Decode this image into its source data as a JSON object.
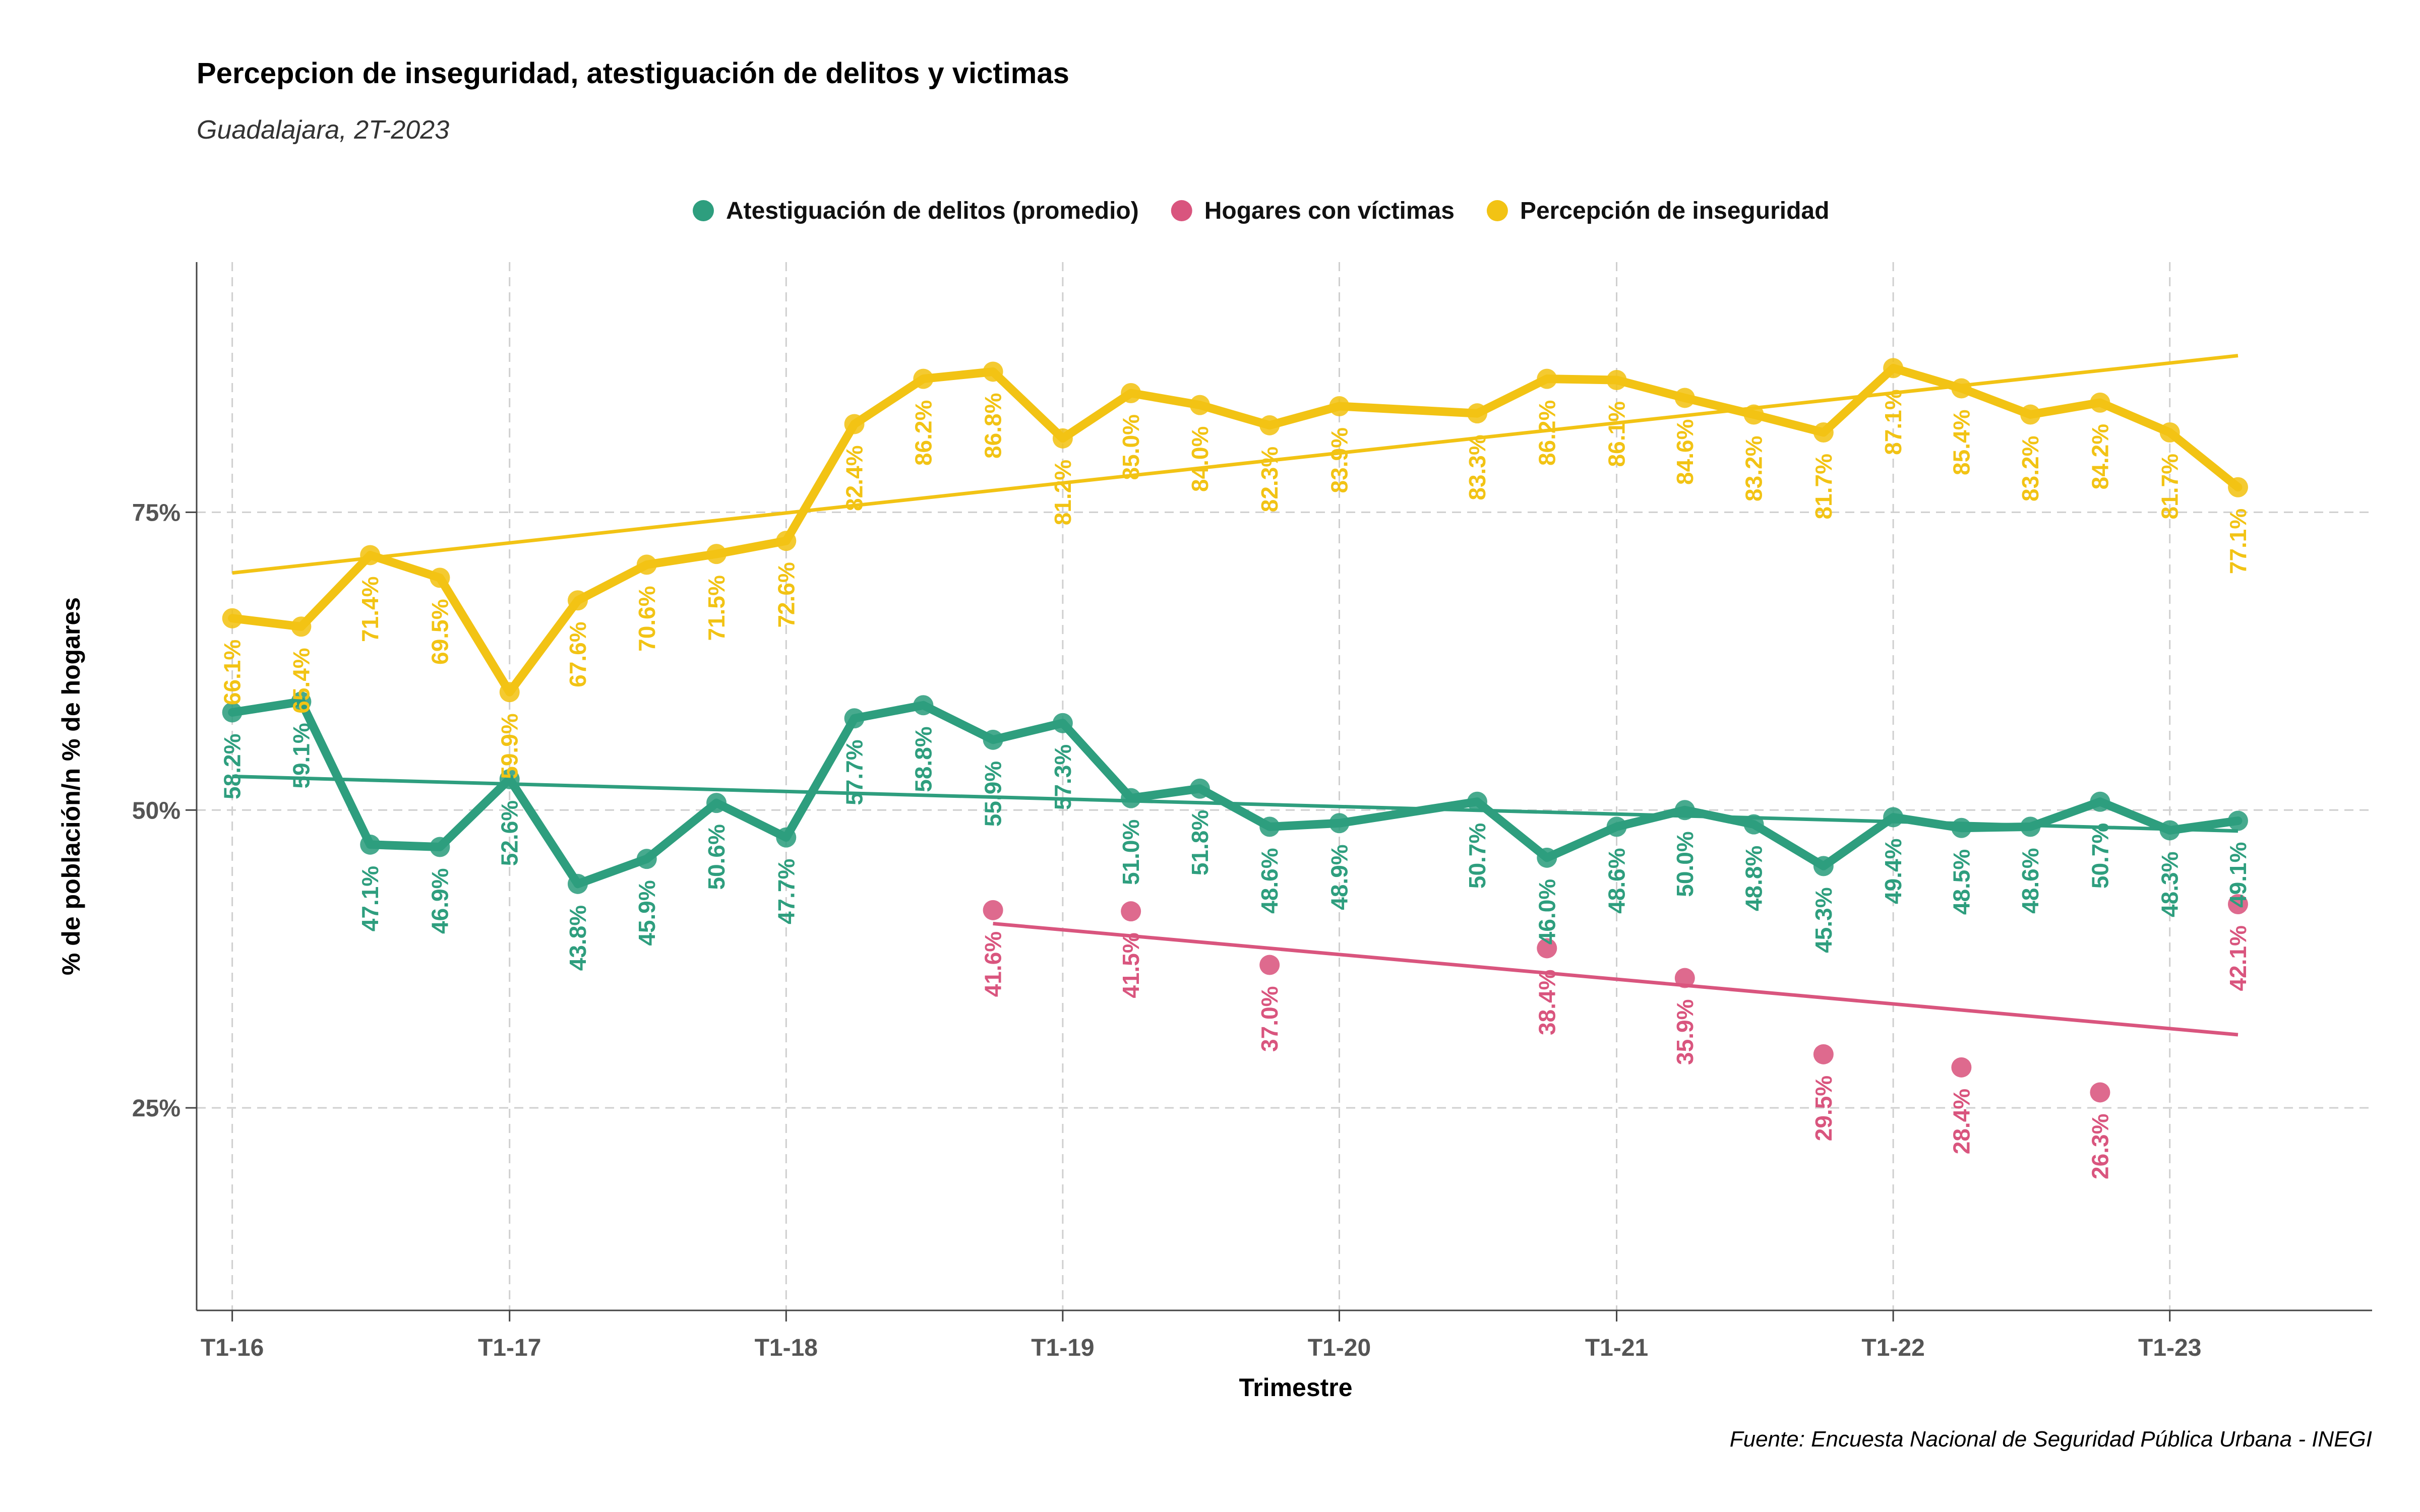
{
  "chart_data": {
    "type": "line",
    "title": "Percepcion de inseguridad, atestiguación de delitos y victimas",
    "subtitle": "Guadalajara, 2T-2023",
    "xlabel": "Trimestre",
    "ylabel": "% de población/n % de hogares",
    "caption": "Fuente: Encuesta Nacional de Seguridad Pública Urbana - INEGI",
    "x_ticks": [
      "T1-16",
      "T1-17",
      "T1-18",
      "T1-19",
      "T1-20",
      "T1-21",
      "T1-22",
      "T1-23"
    ],
    "y_ticks": [
      {
        "value": 25,
        "label": "25%"
      },
      {
        "value": 50,
        "label": "50%"
      },
      {
        "value": 75,
        "label": "75%"
      }
    ],
    "ylim": [
      8,
      96
    ],
    "xlim": [
      "2015-11-15",
      "2023-09-25"
    ],
    "grid": true,
    "legend_position": "top",
    "trend_lines": true,
    "series": [
      {
        "name": "Atestiguación de delitos (promedio)",
        "color": "#2e9e7e",
        "points": [
          {
            "x": "2016-01-01",
            "y": 58.2,
            "label": "58.2%"
          },
          {
            "x": "2016-04-01",
            "y": 59.1,
            "label": "59.1%"
          },
          {
            "x": "2016-07-01",
            "y": 47.1,
            "label": "47.1%"
          },
          {
            "x": "2016-10-01",
            "y": 46.9,
            "label": "46.9%"
          },
          {
            "x": "2017-01-01",
            "y": 52.6,
            "label": "52.6%"
          },
          {
            "x": "2017-04-01",
            "y": 43.8,
            "label": "43.8%"
          },
          {
            "x": "2017-07-01",
            "y": 45.9,
            "label": "45.9%"
          },
          {
            "x": "2017-10-01",
            "y": 50.6,
            "label": "50.6%"
          },
          {
            "x": "2018-01-01",
            "y": 47.7,
            "label": "47.7%"
          },
          {
            "x": "2018-04-01",
            "y": 57.7,
            "label": "57.7%"
          },
          {
            "x": "2018-07-01",
            "y": 58.8,
            "label": "58.8%"
          },
          {
            "x": "2018-10-01",
            "y": 55.9,
            "label": "55.9%"
          },
          {
            "x": "2019-01-01",
            "y": 57.3,
            "label": "57.3%"
          },
          {
            "x": "2019-04-01",
            "y": 51.0,
            "label": "51.0%"
          },
          {
            "x": "2019-07-01",
            "y": 51.8,
            "label": "51.8%"
          },
          {
            "x": "2019-10-01",
            "y": 48.6,
            "label": "48.6%"
          },
          {
            "x": "2020-01-01",
            "y": 48.9,
            "label": "48.9%"
          },
          {
            "x": "2020-07-01",
            "y": 50.7,
            "label": "50.7%"
          },
          {
            "x": "2020-10-01",
            "y": 46.0,
            "label": "46.0%"
          },
          {
            "x": "2021-01-01",
            "y": 48.6,
            "label": "48.6%"
          },
          {
            "x": "2021-04-01",
            "y": 50.0,
            "label": "50.0%"
          },
          {
            "x": "2021-07-01",
            "y": 48.8,
            "label": "48.8%"
          },
          {
            "x": "2021-10-01",
            "y": 45.3,
            "label": "45.3%"
          },
          {
            "x": "2022-01-01",
            "y": 49.4,
            "label": "49.4%"
          },
          {
            "x": "2022-04-01",
            "y": 48.5,
            "label": "48.5%"
          },
          {
            "x": "2022-07-01",
            "y": 48.6,
            "label": "48.6%"
          },
          {
            "x": "2022-10-01",
            "y": 50.7,
            "label": "50.7%"
          },
          {
            "x": "2023-01-01",
            "y": 48.3,
            "label": "48.3%"
          },
          {
            "x": "2023-04-01",
            "y": 49.1,
            "label": "49.1%"
          }
        ]
      },
      {
        "name": "Hogares con víctimas",
        "color": "#d9557e",
        "points": [
          {
            "x": "2018-10-01",
            "y": 41.6,
            "label": "41.6%"
          },
          {
            "x": "2019-04-01",
            "y": 41.5,
            "label": "41.5%"
          },
          {
            "x": "2019-10-01",
            "y": 37.0,
            "label": "37.0%"
          },
          {
            "x": "2020-10-01",
            "y": 38.4,
            "label": "38.4%"
          },
          {
            "x": "2021-04-01",
            "y": 35.9,
            "label": "35.9%"
          },
          {
            "x": "2021-10-01",
            "y": 29.5,
            "label": "29.5%"
          },
          {
            "x": "2022-04-01",
            "y": 28.4,
            "label": "28.4%"
          },
          {
            "x": "2022-10-01",
            "y": 26.3,
            "label": "26.3%"
          },
          {
            "x": "2023-04-01",
            "y": 42.1,
            "label": "42.1%"
          }
        ]
      },
      {
        "name": "Percepción de inseguridad",
        "color": "#f2c314",
        "points": [
          {
            "x": "2016-01-01",
            "y": 66.1,
            "label": "66.1%"
          },
          {
            "x": "2016-04-01",
            "y": 65.4,
            "label": "65.4%"
          },
          {
            "x": "2016-07-01",
            "y": 71.4,
            "label": "71.4%"
          },
          {
            "x": "2016-10-01",
            "y": 69.5,
            "label": "69.5%"
          },
          {
            "x": "2017-01-01",
            "y": 59.9,
            "label": "59.9%"
          },
          {
            "x": "2017-04-01",
            "y": 67.6,
            "label": "67.6%"
          },
          {
            "x": "2017-07-01",
            "y": 70.6,
            "label": "70.6%"
          },
          {
            "x": "2017-10-01",
            "y": 71.5,
            "label": "71.5%"
          },
          {
            "x": "2018-01-01",
            "y": 72.6,
            "label": "72.6%"
          },
          {
            "x": "2018-04-01",
            "y": 82.4,
            "label": "82.4%"
          },
          {
            "x": "2018-07-01",
            "y": 86.2,
            "label": "86.2%"
          },
          {
            "x": "2018-10-01",
            "y": 86.8,
            "label": "86.8%"
          },
          {
            "x": "2019-01-01",
            "y": 81.2,
            "label": "81.2%"
          },
          {
            "x": "2019-04-01",
            "y": 85.0,
            "label": "85.0%"
          },
          {
            "x": "2019-07-01",
            "y": 84.0,
            "label": "84.0%"
          },
          {
            "x": "2019-10-01",
            "y": 82.3,
            "label": "82.3%"
          },
          {
            "x": "2020-01-01",
            "y": 83.9,
            "label": "83.9%"
          },
          {
            "x": "2020-07-01",
            "y": 83.3,
            "label": "83.3%"
          },
          {
            "x": "2020-10-01",
            "y": 86.2,
            "label": "86.2%"
          },
          {
            "x": "2021-01-01",
            "y": 86.1,
            "label": "86.1%"
          },
          {
            "x": "2021-04-01",
            "y": 84.6,
            "label": "84.6%"
          },
          {
            "x": "2021-07-01",
            "y": 83.2,
            "label": "83.2%"
          },
          {
            "x": "2021-10-01",
            "y": 81.7,
            "label": "81.7%"
          },
          {
            "x": "2022-01-01",
            "y": 87.1,
            "label": "87.1%"
          },
          {
            "x": "2022-04-01",
            "y": 85.4,
            "label": "85.4%"
          },
          {
            "x": "2022-07-01",
            "y": 83.2,
            "label": "83.2%"
          },
          {
            "x": "2022-10-01",
            "y": 84.2,
            "label": "84.2%"
          },
          {
            "x": "2023-01-01",
            "y": 81.7,
            "label": "81.7%"
          },
          {
            "x": "2023-04-01",
            "y": 77.1,
            "label": "77.1%"
          }
        ]
      }
    ]
  }
}
